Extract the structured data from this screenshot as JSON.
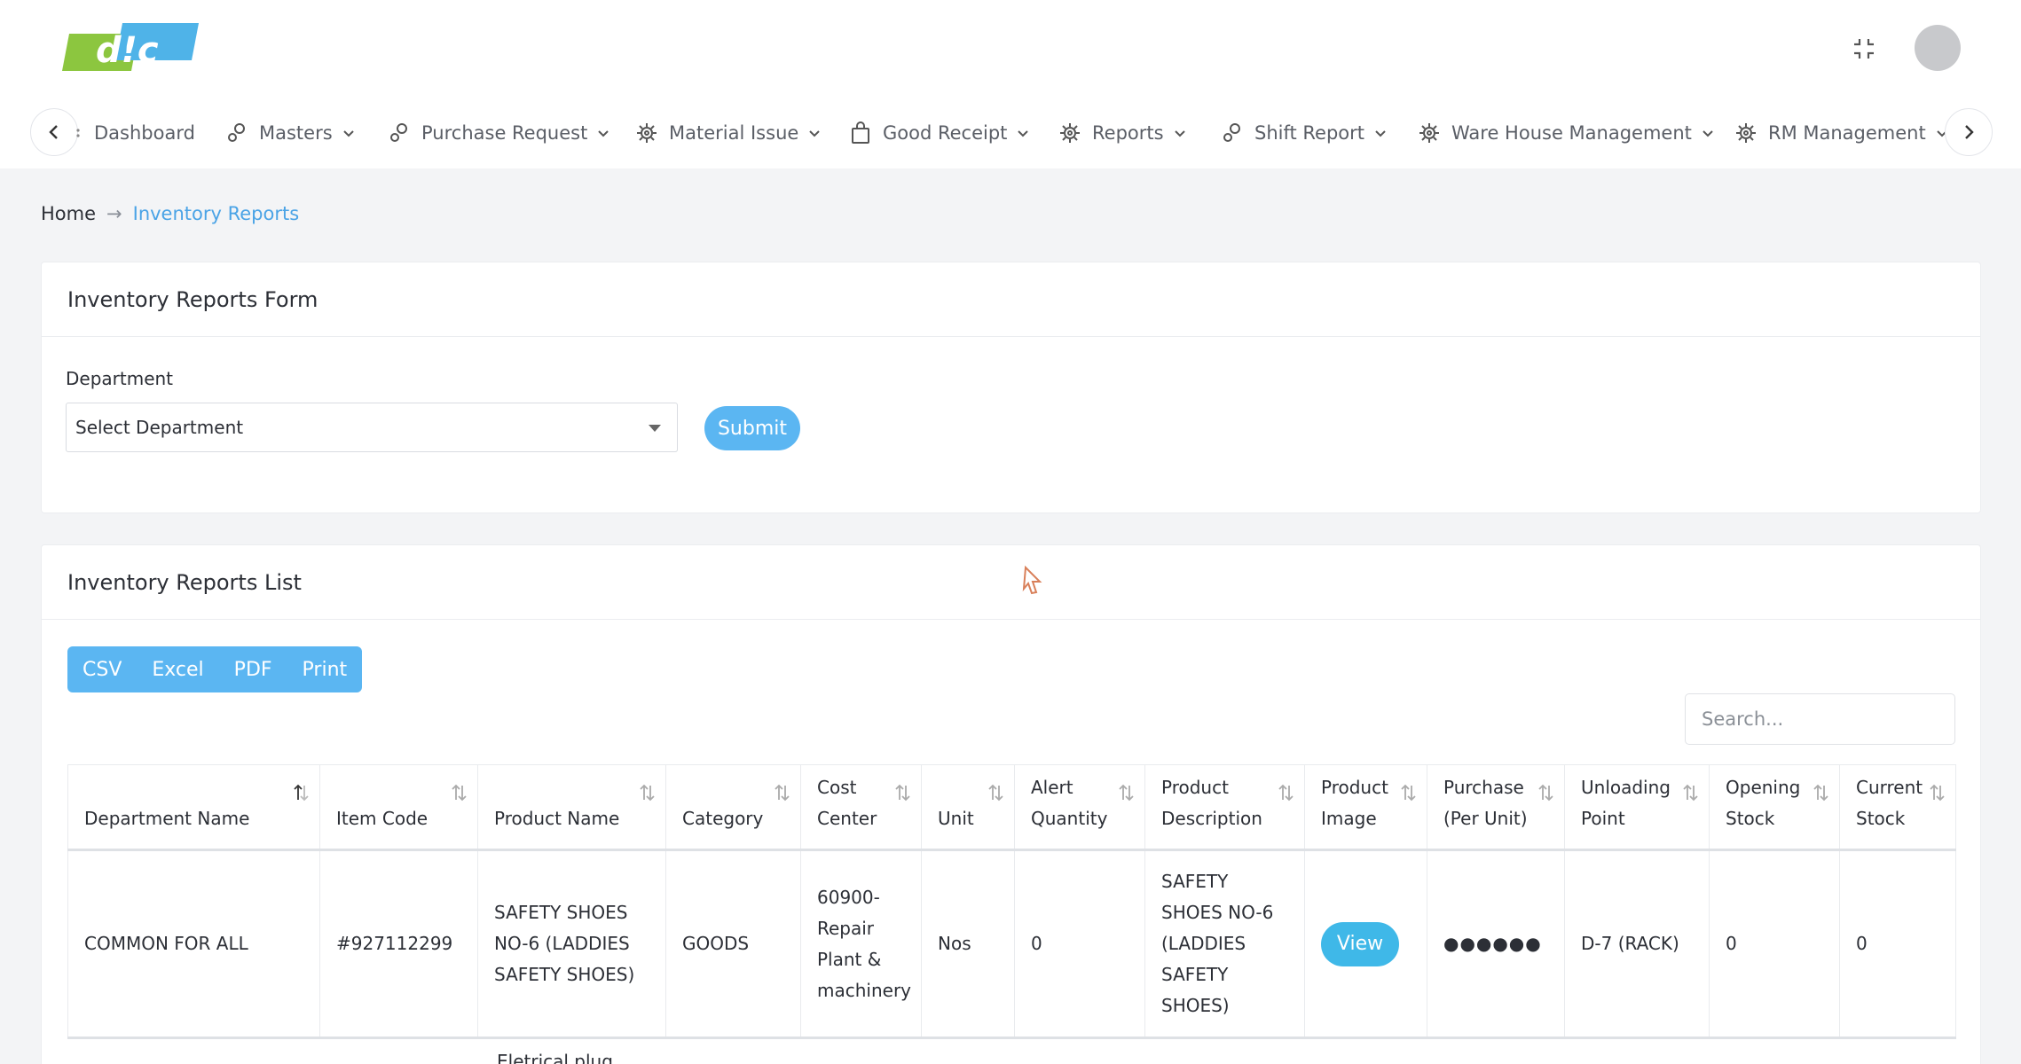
{
  "header": {
    "logo_text": "d!c"
  },
  "nav": {
    "items": [
      {
        "label": "Dashboard",
        "icon": "dashboard-icon"
      },
      {
        "label": "Masters",
        "icon": "circles-icon"
      },
      {
        "label": "Purchase Request",
        "icon": "circles-icon"
      },
      {
        "label": "Material Issue",
        "icon": "gear-icon"
      },
      {
        "label": "Good Receipt",
        "icon": "bag-icon"
      },
      {
        "label": "Reports",
        "icon": "gear-icon"
      },
      {
        "label": "Shift Report",
        "icon": "circles-icon"
      },
      {
        "label": "Ware House Management",
        "icon": "gear-icon"
      },
      {
        "label": "RM Management",
        "icon": "gear-icon"
      }
    ]
  },
  "breadcrumb": {
    "home": "Home",
    "separator": "→",
    "current": "Inventory Reports"
  },
  "form": {
    "title": "Inventory Reports Form",
    "department_label": "Department",
    "department_value": "Select Department",
    "submit_label": "Submit"
  },
  "list": {
    "title": "Inventory Reports List",
    "export": {
      "csv": "CSV",
      "excel": "Excel",
      "pdf": "PDF",
      "print": "Print"
    },
    "search_placeholder": "Search...",
    "columns": [
      "Department Name",
      "Item Code",
      "Product Name",
      "Category",
      "Cost Center",
      "Unit",
      "Alert Quantity",
      "Product Description",
      "Product Image",
      "Purchase (Per Unit)",
      "Unloading Point",
      "Opening Stock",
      "Current Stock"
    ],
    "rows": [
      {
        "department": "COMMON FOR ALL",
        "item_code": "#927112299",
        "product_name": "SAFETY SHOES NO-6 (LADDIES SAFETY SHOES)",
        "category": "GOODS",
        "cost_center": "60900-Repair Plant & machinery",
        "unit": "Nos",
        "alert_qty": "0",
        "description": "SAFETY SHOES NO-6 (LADDIES SAFETY SHOES)",
        "image_button": "View",
        "purchase": "●●●●●●",
        "unloading_point": "D-7 (RACK)",
        "opening_stock": "0",
        "current_stock": "0"
      }
    ],
    "next_row_partial": "Eletrical plug"
  },
  "colors": {
    "accent": "#5bb6f2",
    "view_button": "#3fb8e8",
    "breadcrumb_active": "#4aa3e6",
    "logo_green": "#8cc63f",
    "logo_blue": "#4fb3e8"
  }
}
